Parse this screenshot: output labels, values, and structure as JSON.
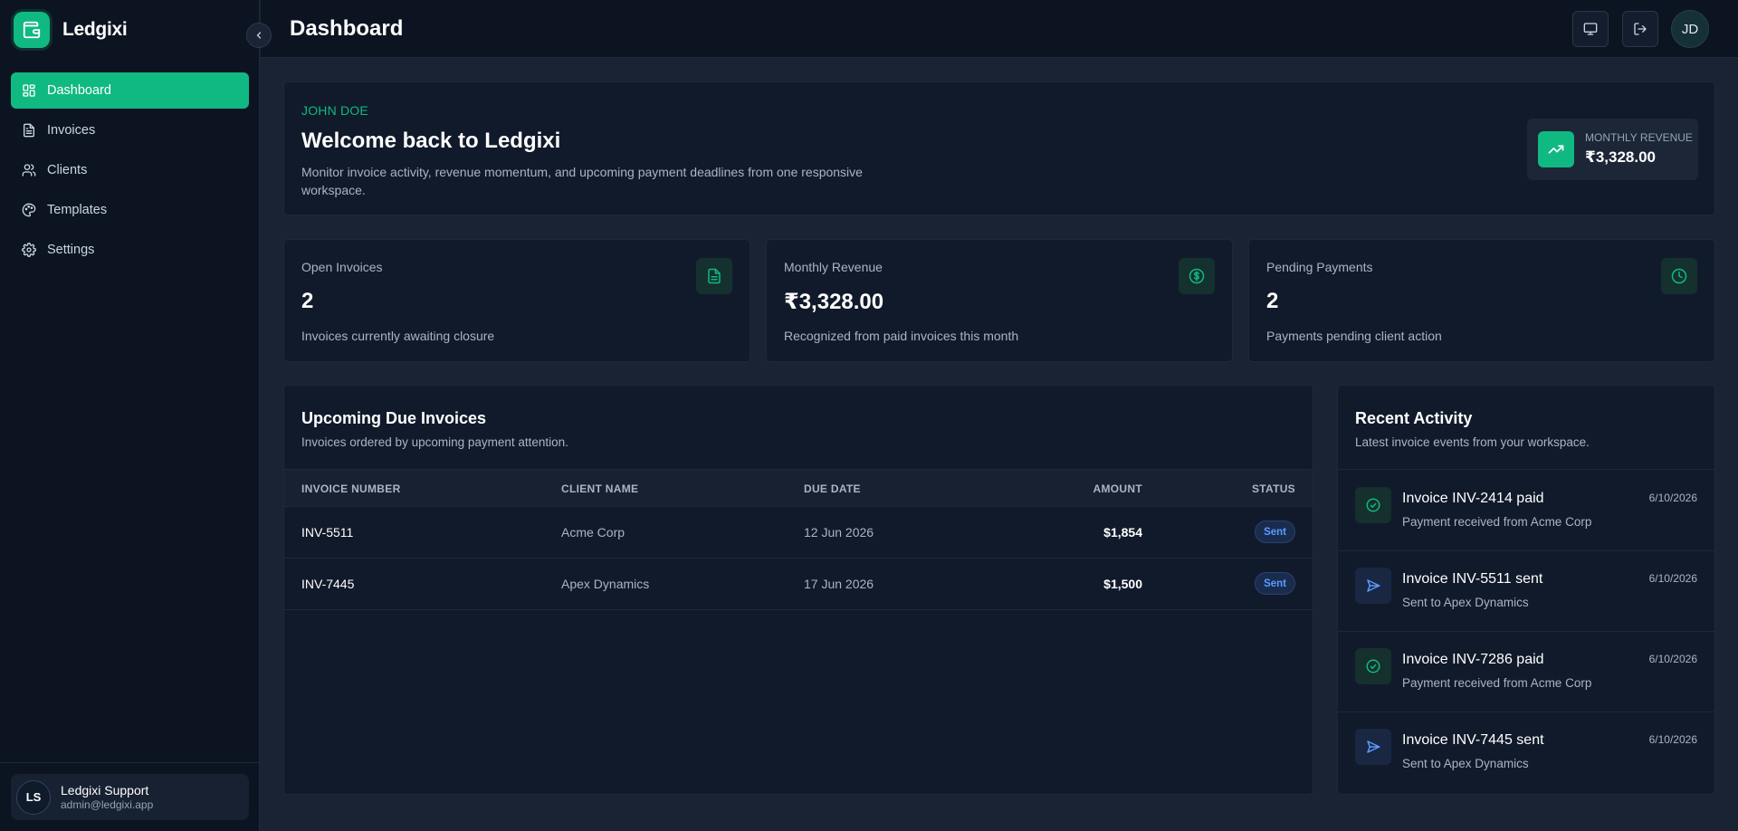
{
  "app": {
    "name": "Ledgixi"
  },
  "sidebar": {
    "items": [
      {
        "label": "Dashboard",
        "icon": "grid-icon",
        "active": true
      },
      {
        "label": "Invoices",
        "icon": "file-text-icon",
        "active": false
      },
      {
        "label": "Clients",
        "icon": "users-icon",
        "active": false
      },
      {
        "label": "Templates",
        "icon": "palette-icon",
        "active": false
      },
      {
        "label": "Settings",
        "icon": "gear-icon",
        "active": false
      }
    ],
    "user": {
      "initials": "LS",
      "name": "Ledgixi Support",
      "email": "admin@ledgixi.app"
    }
  },
  "header": {
    "title": "Dashboard",
    "avatar_initials": "JD"
  },
  "welcome": {
    "eyebrow": "JOHN DOE",
    "title": "Welcome back to Ledgixi",
    "description": "Monitor invoice activity, revenue momentum, and upcoming payment deadlines from one responsive workspace.",
    "badge": {
      "label": "MONTHLY REVENUE",
      "value": "₹3,328.00"
    }
  },
  "stats": [
    {
      "label": "Open Invoices",
      "value": "2",
      "description": "Invoices currently awaiting closure",
      "icon": "file-icon"
    },
    {
      "label": "Monthly Revenue",
      "value": "₹3,328.00",
      "description": "Recognized from paid invoices this month",
      "icon": "dollar-circle-icon"
    },
    {
      "label": "Pending Payments",
      "value": "2",
      "description": "Payments pending client action",
      "icon": "clock-icon"
    }
  ],
  "due_invoices": {
    "title": "Upcoming Due Invoices",
    "subtitle": "Invoices ordered by upcoming payment attention.",
    "columns": [
      "INVOICE NUMBER",
      "CLIENT NAME",
      "DUE DATE",
      "AMOUNT",
      "STATUS"
    ],
    "rows": [
      {
        "number": "INV-5511",
        "client": "Acme Corp",
        "due": "12 Jun 2026",
        "amount": "$1,854",
        "status": "Sent"
      },
      {
        "number": "INV-7445",
        "client": "Apex Dynamics",
        "due": "17 Jun 2026",
        "amount": "$1,500",
        "status": "Sent"
      }
    ]
  },
  "activity": {
    "title": "Recent Activity",
    "subtitle": "Latest invoice events from your workspace.",
    "items": [
      {
        "title": "Invoice INV-2414 paid",
        "subtitle": "Payment received from Acme Corp",
        "date": "6/10/2026",
        "kind": "paid"
      },
      {
        "title": "Invoice INV-5511 sent",
        "subtitle": "Sent to Apex Dynamics",
        "date": "6/10/2026",
        "kind": "sent"
      },
      {
        "title": "Invoice INV-7286 paid",
        "subtitle": "Payment received from Acme Corp",
        "date": "6/10/2026",
        "kind": "paid"
      },
      {
        "title": "Invoice INV-7445 sent",
        "subtitle": "Sent to Apex Dynamics",
        "date": "6/10/2026",
        "kind": "sent"
      }
    ]
  },
  "colors": {
    "accent": "#10b981",
    "background": "#1a2334",
    "sidebar": "#0c1422",
    "card": "#111a2a",
    "status_sent": "#5b9bff"
  }
}
